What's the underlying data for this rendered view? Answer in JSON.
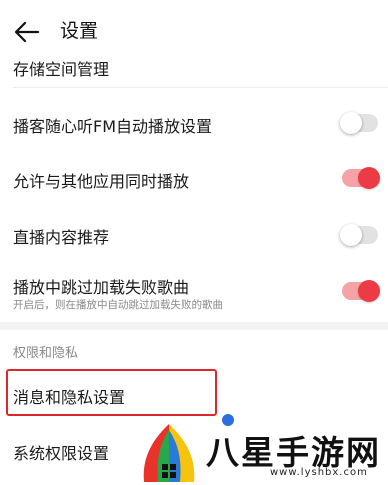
{
  "header": {
    "title": "设置",
    "back_icon": "arrow-left-icon"
  },
  "rows": [
    {
      "label": "存储空间管理"
    },
    {
      "label": "播客随心听FM自动播放设置",
      "toggle": "off"
    },
    {
      "label": "允许与其他应用同时播放",
      "toggle": "on"
    },
    {
      "label": "直播内容推荐",
      "toggle": "off"
    },
    {
      "label": "播放中跳过加载失败歌曲",
      "sublabel": "开启后，则在播放中自动跳过加载失败的歌曲",
      "toggle": "on"
    }
  ],
  "section": {
    "title": "权限和隐私"
  },
  "privacy_rows": [
    {
      "label": "消息和隐私设置"
    },
    {
      "label": "系统权限设置"
    }
  ],
  "colors": {
    "toggle_on": "#ec3b45",
    "toggle_off": "#e2e2e2",
    "highlight": "#e0262b"
  },
  "watermark": {
    "text": "八星手游网",
    "url": "www.lyshbx.com"
  }
}
